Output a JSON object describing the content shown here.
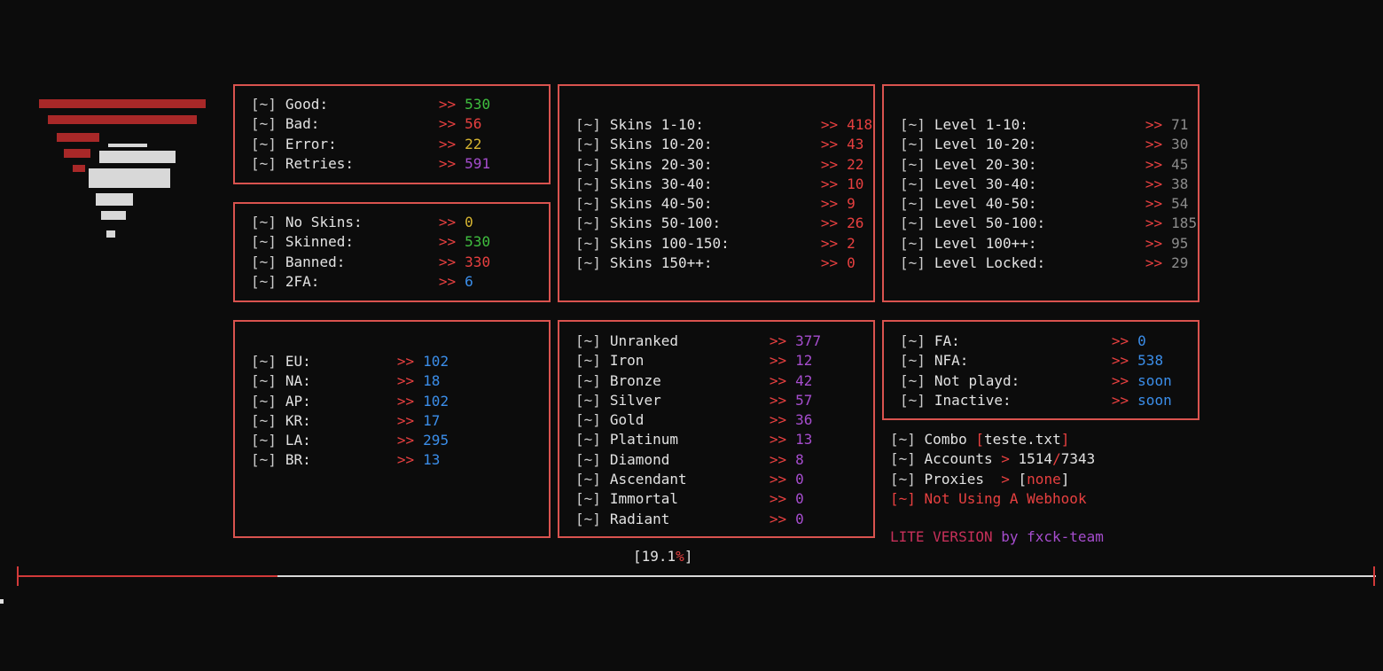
{
  "colors": {
    "border": "#d9534f",
    "arrow": "#e84040",
    "green": "#3fbf3f",
    "red": "#e84040",
    "yellow": "#d7b531",
    "purple": "#a64dce",
    "blue": "#3b8eea",
    "grey": "#8c8c8c",
    "background": "#0c0c0c"
  },
  "status_box": {
    "rows": [
      {
        "prefix": "[~]",
        "label": "Good:",
        "arrow": ">>",
        "value": "530",
        "color": "green"
      },
      {
        "prefix": "[~]",
        "label": "Bad:",
        "arrow": ">>",
        "value": "56",
        "color": "red"
      },
      {
        "prefix": "[~]",
        "label": "Error:",
        "arrow": ">>",
        "value": "22",
        "color": "yellow"
      },
      {
        "prefix": "[~]",
        "label": "Retries:",
        "arrow": ">>",
        "value": "591",
        "color": "purple"
      }
    ]
  },
  "account_box": {
    "rows": [
      {
        "prefix": "[~]",
        "label": "No Skins:",
        "arrow": ">>",
        "value": "0",
        "color": "yellow"
      },
      {
        "prefix": "[~]",
        "label": "Skinned:",
        "arrow": ">>",
        "value": "530",
        "color": "green"
      },
      {
        "prefix": "[~]",
        "label": "Banned:",
        "arrow": ">>",
        "value": "330",
        "color": "red"
      },
      {
        "prefix": "[~]",
        "label": "2FA:",
        "arrow": ">>",
        "value": "6",
        "color": "blue"
      }
    ]
  },
  "skins_box": {
    "rows": [
      {
        "prefix": "[~]",
        "label": "Skins 1-10:",
        "arrow": ">>",
        "value": "418",
        "color": "red"
      },
      {
        "prefix": "[~]",
        "label": "Skins 10-20:",
        "arrow": ">>",
        "value": "43",
        "color": "red"
      },
      {
        "prefix": "[~]",
        "label": "Skins 20-30:",
        "arrow": ">>",
        "value": "22",
        "color": "red"
      },
      {
        "prefix": "[~]",
        "label": "Skins 30-40:",
        "arrow": ">>",
        "value": "10",
        "color": "red"
      },
      {
        "prefix": "[~]",
        "label": "Skins 40-50:",
        "arrow": ">>",
        "value": "9",
        "color": "red"
      },
      {
        "prefix": "[~]",
        "label": "Skins 50-100:",
        "arrow": ">>",
        "value": "26",
        "color": "red"
      },
      {
        "prefix": "[~]",
        "label": "Skins 100-150:",
        "arrow": ">>",
        "value": "2",
        "color": "red"
      },
      {
        "prefix": "[~]",
        "label": "Skins 150++:",
        "arrow": ">>",
        "value": "0",
        "color": "red"
      }
    ]
  },
  "level_box": {
    "rows": [
      {
        "prefix": "[~]",
        "label": "Level 1-10:",
        "arrow": ">>",
        "value": "71",
        "color": "grey"
      },
      {
        "prefix": "[~]",
        "label": "Level 10-20:",
        "arrow": ">>",
        "value": "30",
        "color": "grey"
      },
      {
        "prefix": "[~]",
        "label": "Level 20-30:",
        "arrow": ">>",
        "value": "45",
        "color": "grey"
      },
      {
        "prefix": "[~]",
        "label": "Level 30-40:",
        "arrow": ">>",
        "value": "38",
        "color": "grey"
      },
      {
        "prefix": "[~]",
        "label": "Level 40-50:",
        "arrow": ">>",
        "value": "54",
        "color": "grey"
      },
      {
        "prefix": "[~]",
        "label": "Level 50-100:",
        "arrow": ">>",
        "value": "185",
        "color": "grey"
      },
      {
        "prefix": "[~]",
        "label": "Level 100++:",
        "arrow": ">>",
        "value": "95",
        "color": "grey"
      },
      {
        "prefix": "[~]",
        "label": "Level Locked:",
        "arrow": ">>",
        "value": "29",
        "color": "grey"
      }
    ]
  },
  "region_box": {
    "rows": [
      {
        "prefix": "[~]",
        "label": "EU:",
        "arrow": ">>",
        "value": "102",
        "color": "blue"
      },
      {
        "prefix": "[~]",
        "label": "NA:",
        "arrow": ">>",
        "value": "18",
        "color": "blue"
      },
      {
        "prefix": "[~]",
        "label": "AP:",
        "arrow": ">>",
        "value": "102",
        "color": "blue"
      },
      {
        "prefix": "[~]",
        "label": "KR:",
        "arrow": ">>",
        "value": "17",
        "color": "blue"
      },
      {
        "prefix": "[~]",
        "label": "LA:",
        "arrow": ">>",
        "value": "295",
        "color": "blue"
      },
      {
        "prefix": "[~]",
        "label": "BR:",
        "arrow": ">>",
        "value": "13",
        "color": "blue"
      }
    ]
  },
  "rank_box": {
    "rows": [
      {
        "prefix": "[~]",
        "label": "Unranked",
        "arrow": ">>",
        "value": "377",
        "color": "purple"
      },
      {
        "prefix": "[~]",
        "label": "Iron",
        "arrow": ">>",
        "value": "12",
        "color": "purple"
      },
      {
        "prefix": "[~]",
        "label": "Bronze",
        "arrow": ">>",
        "value": "42",
        "color": "purple"
      },
      {
        "prefix": "[~]",
        "label": "Silver",
        "arrow": ">>",
        "value": "57",
        "color": "purple"
      },
      {
        "prefix": "[~]",
        "label": "Gold",
        "arrow": ">>",
        "value": "36",
        "color": "purple"
      },
      {
        "prefix": "[~]",
        "label": "Platinum",
        "arrow": ">>",
        "value": "13",
        "color": "purple"
      },
      {
        "prefix": "[~]",
        "label": "Diamond",
        "arrow": ">>",
        "value": "8",
        "color": "purple"
      },
      {
        "prefix": "[~]",
        "label": "Ascendant",
        "arrow": ">>",
        "value": "0",
        "color": "purple"
      },
      {
        "prefix": "[~]",
        "label": "Immortal",
        "arrow": ">>",
        "value": "0",
        "color": "purple"
      },
      {
        "prefix": "[~]",
        "label": "Radiant",
        "arrow": ">>",
        "value": "0",
        "color": "purple"
      }
    ]
  },
  "mail_box": {
    "rows": [
      {
        "prefix": "[~]",
        "label": "FA:",
        "arrow": ">>",
        "value": "0",
        "color": "blue"
      },
      {
        "prefix": "[~]",
        "label": "NFA:",
        "arrow": ">>",
        "value": "538",
        "color": "blue"
      },
      {
        "prefix": "[~]",
        "label": "Not playd:",
        "arrow": ">>",
        "value": "soon",
        "color": "blue"
      },
      {
        "prefix": "[~]",
        "label": "Inactive:",
        "arrow": ">>",
        "value": "soon",
        "color": "blue"
      }
    ]
  },
  "info": {
    "combo_label": "Combo",
    "combo_open": "[",
    "combo_file": "teste.txt",
    "combo_close": "]",
    "accounts_label": "Accounts",
    "accounts_arrow": ">",
    "accounts_done": "1514",
    "accounts_sep": "/",
    "accounts_total": "7343",
    "proxies_label": "Proxies",
    "proxies_arrow": ">",
    "proxies_open": "[",
    "proxies_value": "none",
    "proxies_close": "]",
    "webhook_text": "Not Using A Webhook",
    "prefix": "[~]"
  },
  "footer": {
    "lite": "LITE VERSION",
    "by": "by fxck-team"
  },
  "progress": {
    "open": "[",
    "number": "19.1",
    "percent_sign": "%",
    "close": "]",
    "fraction": 0.191
  }
}
